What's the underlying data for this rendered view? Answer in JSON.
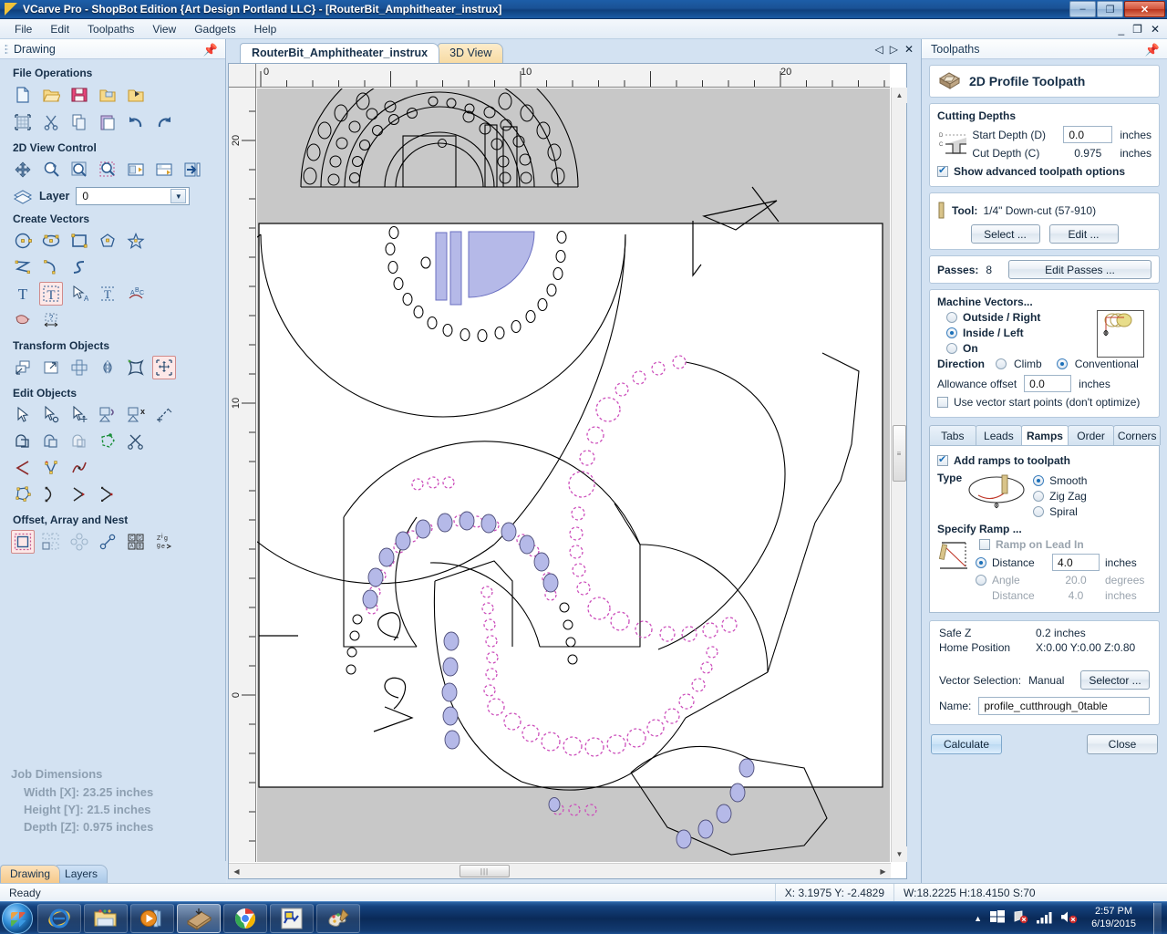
{
  "window": {
    "title": "VCarve Pro - ShopBot Edition {Art Design Portland LLC} - [RouterBit_Amphitheater_instrux]",
    "minimize": "–",
    "maximize": "❐",
    "close": "✕",
    "mdi_minimize": "_",
    "mdi_restore": "❐",
    "mdi_close": "✕"
  },
  "menu": {
    "items": [
      "File",
      "Edit",
      "Toolpaths",
      "View",
      "Gadgets",
      "Help"
    ]
  },
  "left_panel": {
    "header_title": "Drawing",
    "pin_icon": "pin-icon",
    "groups": [
      {
        "title": "File Operations",
        "rows": [
          [
            "new-file-icon",
            "open-file-icon",
            "save-file-icon",
            "import-file-icon",
            "export-file-icon"
          ],
          [
            "job-setup-icon",
            "cut-icon",
            "copy-icon",
            "paste-icon",
            "undo-icon",
            "redo-icon"
          ]
        ]
      },
      {
        "title": "2D View Control",
        "rows": [
          [
            "pan-icon",
            "zoom-in-icon",
            "zoom-selected-icon",
            "zoom-box-icon",
            "zoom-drawing-icon",
            "zoom-job-icon",
            "toggle-panel-icon"
          ]
        ]
      },
      {
        "title": "Create Vectors",
        "rows": [
          [
            "circle-icon",
            "ellipse-icon",
            "rectangle-icon",
            "polygon-icon",
            "star-icon"
          ],
          [
            "polyline-icon",
            "arc-icon",
            "curve-icon"
          ],
          [
            "create-text-icon",
            "text-selected-icon",
            "edit-text-icon",
            "text-on-curve-icon",
            "text-arc-icon"
          ],
          [
            "trace-bitmap-icon",
            "dimension-icon"
          ]
        ]
      },
      {
        "title": "Transform Objects",
        "rows": [
          [
            "move-objects-icon",
            "scale-objects-icon",
            "align-objects-icon",
            "mirror-objects-icon",
            "distort-objects-icon",
            "center-objects-icon"
          ]
        ]
      },
      {
        "title": "Edit Objects",
        "rows": [
          [
            "select-arrow-icon",
            "node-edit-icon",
            "move-node-icon",
            "join-vectors-icon",
            "close-vectors-icon",
            "measure-icon"
          ],
          [
            "weld-icon",
            "subtract-icon",
            "intersect-icon",
            "trim-icon",
            "scissors-icon"
          ],
          [
            "fillet-icon",
            "node-tools-icon",
            "smooth-curve-icon"
          ],
          [
            "polygon-nodes-icon",
            "start-point-icon",
            "reverse-direction-icon",
            "add-node-icon"
          ]
        ]
      },
      {
        "title": "Offset, Array and Nest",
        "rows": [
          [
            "offset-selected-icon",
            "array-copy-icon",
            "circular-array-icon",
            "nest-objects-icon",
            "block-copy-icon",
            "zig-zag-nest-icon"
          ]
        ]
      }
    ],
    "layer": {
      "label": "Layer",
      "value": "0"
    },
    "job_dimensions": {
      "title": "Job Dimensions",
      "width": "Width  [X]: 23.25 inches",
      "height": "Height [Y]: 21.5 inches",
      "depth": "Depth  [Z]: 0.975 inches"
    },
    "tabs": [
      {
        "label": "Drawing",
        "active": true
      },
      {
        "label": "Layers",
        "active": false
      }
    ]
  },
  "document": {
    "tabs": [
      {
        "label": "RouterBit_Amphitheater_instrux",
        "active": true
      },
      {
        "label": "3D View",
        "active": false
      }
    ],
    "nav_prev": "◁",
    "nav_next": "▷",
    "nav_close": "✕",
    "ruler_h_labels": [
      "0",
      "10",
      "20"
    ],
    "ruler_v_labels": [
      "20",
      "10",
      "0"
    ]
  },
  "toolpaths": {
    "header_title": "Toolpaths",
    "pin_icon": "pin-icon",
    "operation_name": "2D Profile Toolpath",
    "operation_icon": "profile-toolpath-icon",
    "cutting_depths": {
      "title": "Cutting Depths",
      "start_depth_label": "Start Depth (D)",
      "start_depth_value": "0.0",
      "start_depth_units": "inches",
      "cut_depth_label": "Cut Depth (C)",
      "cut_depth_value": "0.975",
      "cut_depth_units": "inches",
      "advanced_label": "Show advanced toolpath options",
      "advanced_checked": true
    },
    "tool": {
      "label": "Tool:",
      "name": "1/4\" Down-cut (57-910)",
      "select_button": "Select ...",
      "edit_button": "Edit ..."
    },
    "passes": {
      "label": "Passes:",
      "value": "8",
      "edit_button": "Edit Passes ..."
    },
    "machine_vectors": {
      "title": "Machine Vectors...",
      "options": [
        {
          "label": "Outside / Right",
          "selected": false
        },
        {
          "label": "Inside / Left",
          "selected": true
        },
        {
          "label": "On",
          "selected": false
        }
      ],
      "direction_label": "Direction",
      "direction_options": [
        {
          "label": "Climb",
          "selected": false
        },
        {
          "label": "Conventional",
          "selected": true
        }
      ],
      "allowance_label": "Allowance offset",
      "allowance_value": "0.0",
      "allowance_units": "inches",
      "start_points_label": "Use vector start points (don't optimize)",
      "start_points_checked": false
    },
    "tabs": [
      {
        "label": "Tabs",
        "active": false
      },
      {
        "label": "Leads",
        "active": false
      },
      {
        "label": "Ramps",
        "active": true
      },
      {
        "label": "Order",
        "active": false
      },
      {
        "label": "Corners",
        "active": false
      }
    ],
    "ramps": {
      "add_ramps_label": "Add ramps to toolpath",
      "add_ramps_checked": true,
      "type_label": "Type",
      "type_options": [
        {
          "label": "Smooth",
          "selected": true
        },
        {
          "label": "Zig Zag",
          "selected": false
        },
        {
          "label": "Spiral",
          "selected": false
        }
      ],
      "specify_label": "Specify Ramp ...",
      "lead_in_label": "Ramp on Lead In",
      "lead_in_checked": false,
      "distance_label": "Distance",
      "distance_value": "4.0",
      "distance_units": "inches",
      "angle_label": "Angle",
      "angle_value": "20.0",
      "angle_units": "degrees",
      "angle_distance_label": "Distance",
      "angle_distance_value": "4.0",
      "angle_distance_units": "inches"
    },
    "footer": {
      "safe_z_label": "Safe Z",
      "safe_z_value": "0.2 inches",
      "home_label": "Home Position",
      "home_value": "X:0.00 Y:0.00 Z:0.80",
      "vector_selection_label": "Vector Selection:",
      "vector_selection_value": "Manual",
      "selector_button": "Selector ...",
      "name_label": "Name:",
      "name_value": "profile_cutthrough_0table",
      "calculate_button": "Calculate",
      "close_button": "Close"
    }
  },
  "statusbar": {
    "ready": "Ready",
    "coords": "X:  3.1975 Y: -2.4829",
    "dims": "W:18.2225   H:18.4150   S:70"
  },
  "taskbar": {
    "start": "start-orb-icon",
    "items": [
      {
        "name": "internet-explorer-icon",
        "active": false
      },
      {
        "name": "file-explorer-icon",
        "active": false
      },
      {
        "name": "media-player-icon",
        "active": false
      },
      {
        "name": "vcarve-pro-icon",
        "active": true
      },
      {
        "name": "google-chrome-icon",
        "active": false
      },
      {
        "name": "shopbot-icon",
        "active": false
      },
      {
        "name": "paint-icon",
        "active": false
      }
    ],
    "tray": {
      "show_hidden": "▲",
      "network_icon": "network-disconnected-icon",
      "signal_icon": "signal-bars-icon",
      "volume_icon": "volume-muted-icon",
      "time": "2:57 PM",
      "date": "6/19/2015"
    }
  },
  "colors": {
    "selected_fill": "#b5b9e8",
    "toolpath_preview": "#cc4ebb",
    "accent_blue": "#1b6fb8",
    "panel_bg": "#d3e2f2",
    "title_bar": "#14417d"
  }
}
